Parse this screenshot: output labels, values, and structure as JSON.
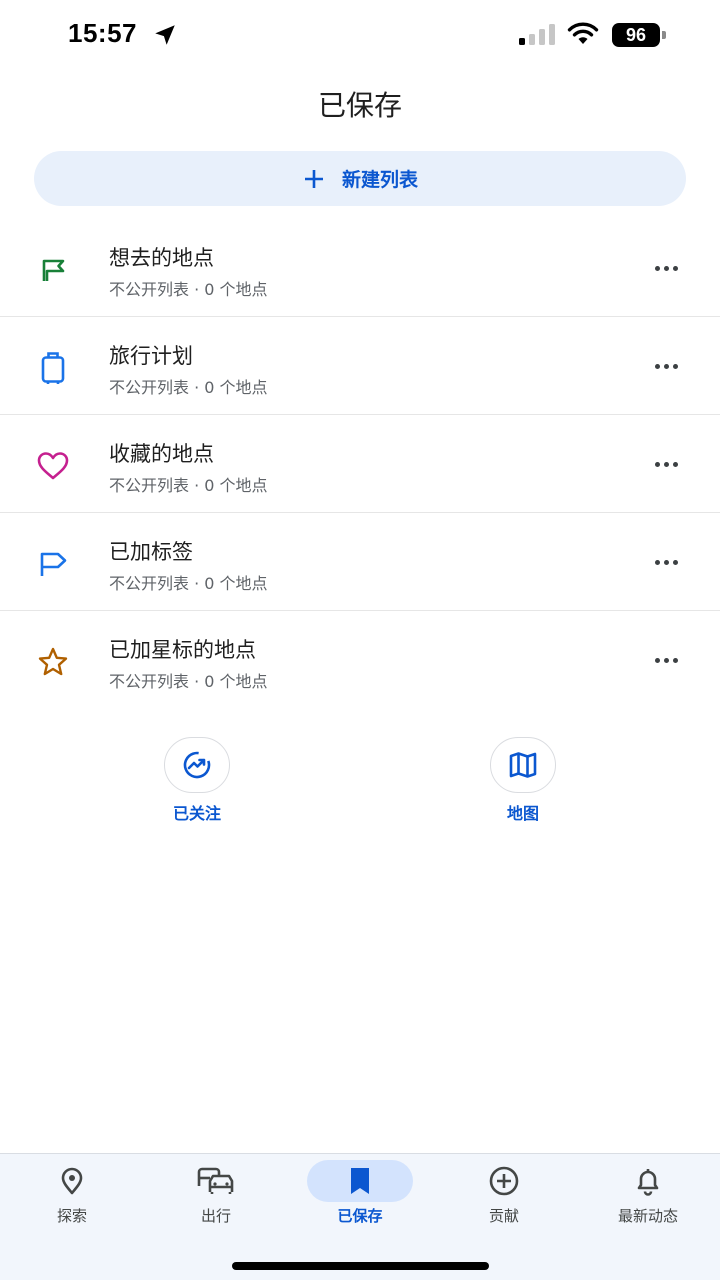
{
  "status_bar": {
    "time": "15:57",
    "battery": "96"
  },
  "header": {
    "title": "已保存"
  },
  "new_list": {
    "label": "新建列表",
    "icon": "plus-icon"
  },
  "lists": [
    {
      "title": "想去的地点",
      "subtitle": "不公开列表 · 0 个地点",
      "icon": "flag-icon",
      "color": "#188038"
    },
    {
      "title": "旅行计划",
      "subtitle": "不公开列表 · 0 个地点",
      "icon": "suitcase-icon",
      "color": "#1a73e8"
    },
    {
      "title": "收藏的地点",
      "subtitle": "不公开列表 · 0 个地点",
      "icon": "heart-icon",
      "color": "#c5208f"
    },
    {
      "title": "已加标签",
      "subtitle": "不公开列表 · 0 个地点",
      "icon": "label-flag-icon",
      "color": "#1a73e8"
    },
    {
      "title": "已加星标的地点",
      "subtitle": "不公开列表 · 0 个地点",
      "icon": "star-icon",
      "color": "#b06000"
    }
  ],
  "shortcuts": {
    "following": {
      "label": "已关注",
      "icon": "following-icon"
    },
    "map": {
      "label": "地图",
      "icon": "map-icon"
    }
  },
  "bottom_nav": [
    {
      "label": "探索",
      "icon": "location-pin-icon"
    },
    {
      "label": "出行",
      "icon": "commute-icon"
    },
    {
      "label": "已保存",
      "icon": "bookmark-icon",
      "active": true
    },
    {
      "label": "贡献",
      "icon": "add-circle-icon"
    },
    {
      "label": "最新动态",
      "icon": "bell-icon"
    }
  ],
  "colors": {
    "accent": "#0b57d0",
    "button_bg": "#e8f0fb",
    "nav_bg": "#f2f6fc",
    "nav_active_bg": "#d3e3fd"
  }
}
